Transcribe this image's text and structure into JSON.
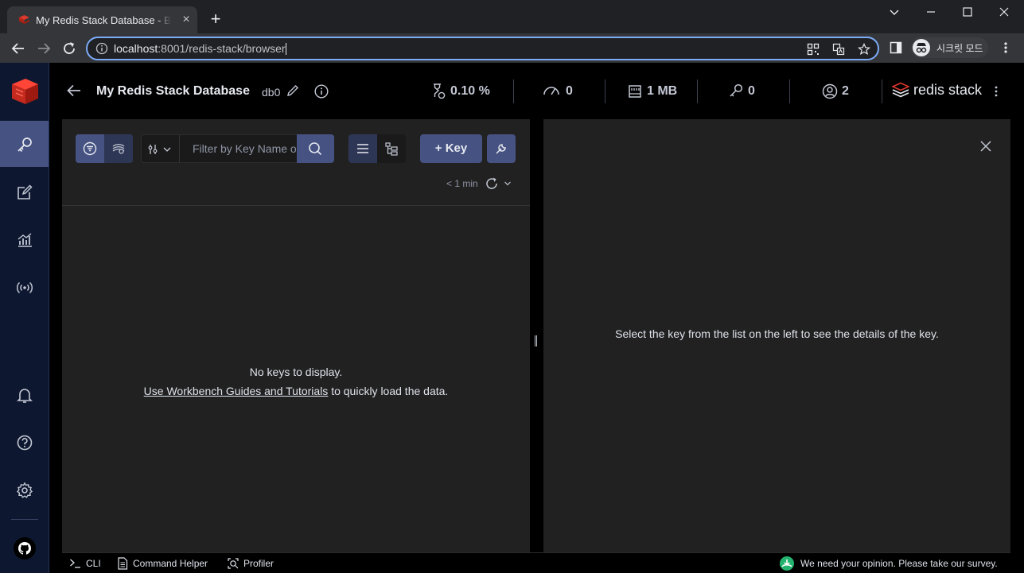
{
  "browser": {
    "tab_title": "My Redis Stack Database - Browser",
    "url_host": "localhost",
    "url_rest": ":8001/redis-stack/browser",
    "profile_label": "시크릿 모드"
  },
  "header": {
    "db_name": "My Redis Stack Database",
    "db_index": "db0",
    "cpu": "0.10 %",
    "ops": "0",
    "memory": "1 MB",
    "keys": "0",
    "clients": "2",
    "brand": "redis stack"
  },
  "browser_panel": {
    "filter_placeholder": "Filter by Key Name or Pattern",
    "add_key_label": "+ Key",
    "refresh_ago": "< 1 min",
    "empty_title": "No keys to display.",
    "empty_link": "Use Workbench Guides and Tutorials",
    "empty_suffix": " to quickly load the data."
  },
  "details_panel": {
    "placeholder": "Select the key from the list on the left to see the details of the key."
  },
  "bottom_bar": {
    "cli": "CLI",
    "command_helper": "Command Helper",
    "profiler": "Profiler",
    "survey": "We need your opinion. Please take our survey."
  },
  "sidebar": {
    "items": [
      "browser-icon",
      "workbench-icon",
      "analysis-icon",
      "pubsub-icon",
      "notifications-icon",
      "help-icon",
      "settings-icon",
      "github-icon"
    ]
  },
  "colors": {
    "accent": "#465282",
    "sidebar_bg": "#0d1830",
    "panel_bg": "#212121",
    "redis_red": "#dc382c",
    "survey_green": "#24b36e",
    "focus_ring": "#7cacf8"
  }
}
